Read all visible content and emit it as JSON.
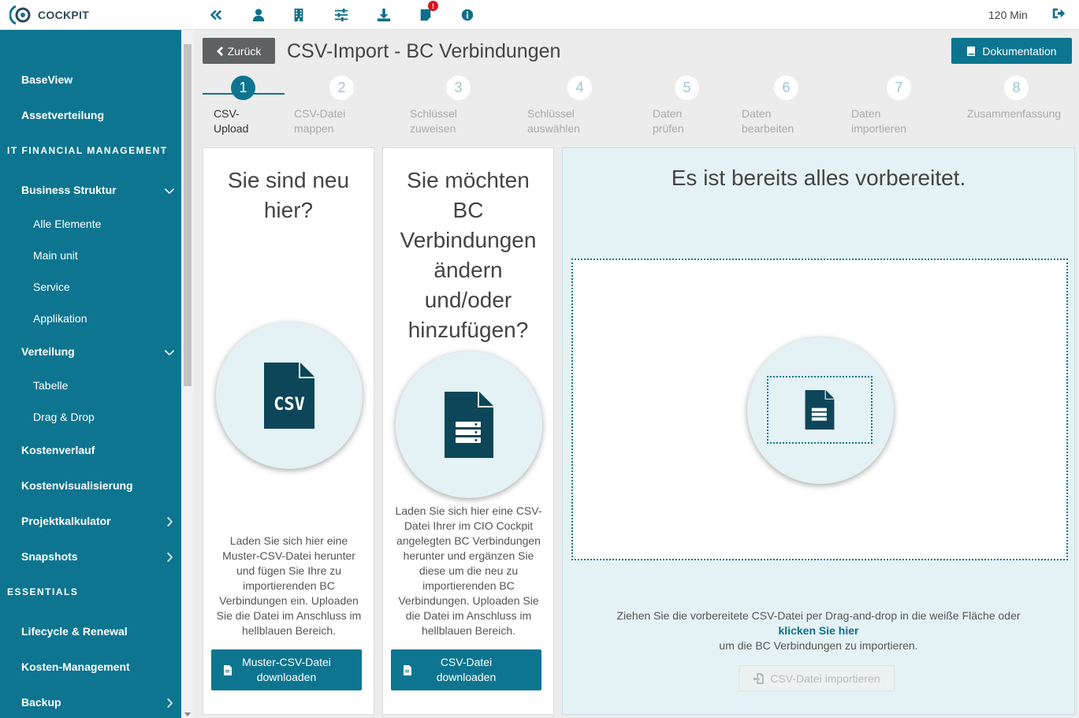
{
  "app": {
    "name": "COCKPIT",
    "session_time": "120 Min"
  },
  "toolbar": {
    "icons": [
      "collapse-icon",
      "user-icon",
      "building-icon",
      "sliders-icon",
      "download-icon",
      "notes-icon",
      "info-icon"
    ],
    "notification_count": "!"
  },
  "sidebar": {
    "items": [
      {
        "label": "BaseView",
        "type": "item"
      },
      {
        "label": "Assetverteilung",
        "type": "item"
      },
      {
        "label": "IT FINANCIAL MANAGEMENT",
        "type": "heading"
      },
      {
        "label": "Business Struktur",
        "type": "item",
        "chevron": "down"
      },
      {
        "label": "Alle Elemente",
        "type": "sub"
      },
      {
        "label": "Main unit",
        "type": "sub"
      },
      {
        "label": "Service",
        "type": "sub"
      },
      {
        "label": "Applikation",
        "type": "sub"
      },
      {
        "label": "Verteilung",
        "type": "item",
        "chevron": "down"
      },
      {
        "label": "Tabelle",
        "type": "sub"
      },
      {
        "label": "Drag & Drop",
        "type": "sub"
      },
      {
        "label": "Kostenverlauf",
        "type": "item"
      },
      {
        "label": "Kostenvisualisierung",
        "type": "item"
      },
      {
        "label": "Projektkalkulator",
        "type": "item",
        "chevron": "right"
      },
      {
        "label": "Snapshots",
        "type": "item",
        "chevron": "right"
      },
      {
        "label": "ESSENTIALS",
        "type": "heading"
      },
      {
        "label": "Lifecycle & Renewal",
        "type": "item"
      },
      {
        "label": "Kosten-Management",
        "type": "item"
      },
      {
        "label": "Backup",
        "type": "item",
        "chevron": "right"
      }
    ]
  },
  "header": {
    "back_label": "Zurück",
    "title": "CSV-Import - BC Verbindungen",
    "doc_label": "Dokumentation"
  },
  "stepper": {
    "current": 1,
    "steps": [
      {
        "num": "1",
        "line1": "CSV-",
        "line2": "Upload"
      },
      {
        "num": "2",
        "line1": "CSV-Datei",
        "line2": "mappen"
      },
      {
        "num": "3",
        "line1": "Schlüssel",
        "line2": "zuweisen"
      },
      {
        "num": "4",
        "line1": "Schlüssel",
        "line2": "auswählen"
      },
      {
        "num": "5",
        "line1": "Daten",
        "line2": "prüfen"
      },
      {
        "num": "6",
        "line1": "Daten",
        "line2": "bearbeiten"
      },
      {
        "num": "7",
        "line1": "Daten",
        "line2": "importieren"
      },
      {
        "num": "8",
        "line1": "Zusammenfassung",
        "line2": ""
      }
    ]
  },
  "panel_new": {
    "title_lines": [
      "Sie sind neu",
      "hier?"
    ],
    "text_lines": [
      "Laden Sie sich hier eine",
      "Muster-CSV-Datei herunter",
      "und fügen Sie Ihre zu",
      "importierenden BC",
      "Verbindungen ein. Uploaden",
      "Sie die Datei im Anschluss im",
      "hellblauen Bereich."
    ],
    "button_lines": [
      "Muster-CSV-Datei",
      "downloaden"
    ],
    "icon": "csv-file-icon"
  },
  "panel_edit": {
    "title_lines": [
      "Sie möchten",
      "BC",
      "Verbindungen",
      "ändern",
      "und/oder",
      "hinzufügen?"
    ],
    "text_lines": [
      "Laden Sie sich hier eine CSV-",
      "Datei Ihrer im CIO Cockpit",
      "angelegten BC Verbindungen",
      "herunter und ergänzen Sie",
      "diese um die neu zu",
      "importierenden BC",
      "Verbindungen. Uploaden Sie",
      "die Datei im Anschluss im",
      "hellblauen Bereich."
    ],
    "button_lines": [
      "CSV-Datei",
      "downloaden"
    ],
    "icon": "data-file-icon"
  },
  "panel_drop": {
    "title": "Es ist bereits alles vorbereitet.",
    "text_line1": "Ziehen Sie die vorbereitete CSV-Datei per Drag-and-drop in die weiße Fläche oder",
    "link": "klicken Sie hier",
    "text_line3": "um die BC Verbindungen zu importieren.",
    "import_label": "CSV-Datei importieren"
  },
  "colors": {
    "primary": "#0e7590",
    "sidebar": "#0e7590",
    "panel_blue": "#e4f2f5",
    "badge": "#d9141e"
  }
}
